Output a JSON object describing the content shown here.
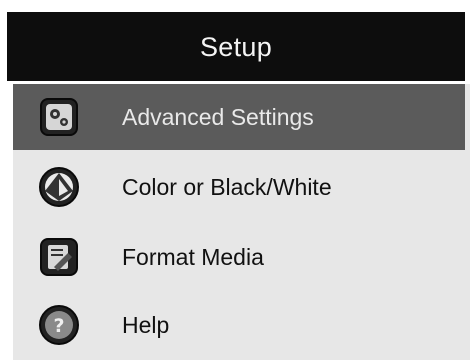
{
  "header": {
    "title": "Setup"
  },
  "menu": {
    "items": [
      {
        "label": "Advanced Settings",
        "icon": "gears-icon",
        "selected": true
      },
      {
        "label": "Color or Black/White",
        "icon": "color-mode-icon",
        "selected": false
      },
      {
        "label": "Format Media",
        "icon": "format-media-icon",
        "selected": false
      },
      {
        "label": "Help",
        "icon": "help-icon",
        "selected": false
      }
    ]
  },
  "colors": {
    "title_bar": "#0d0d0d",
    "menu_bg": "#e7e7e7",
    "selected_bg": "#5b5b5b",
    "selected_text": "#e9e9e9"
  }
}
